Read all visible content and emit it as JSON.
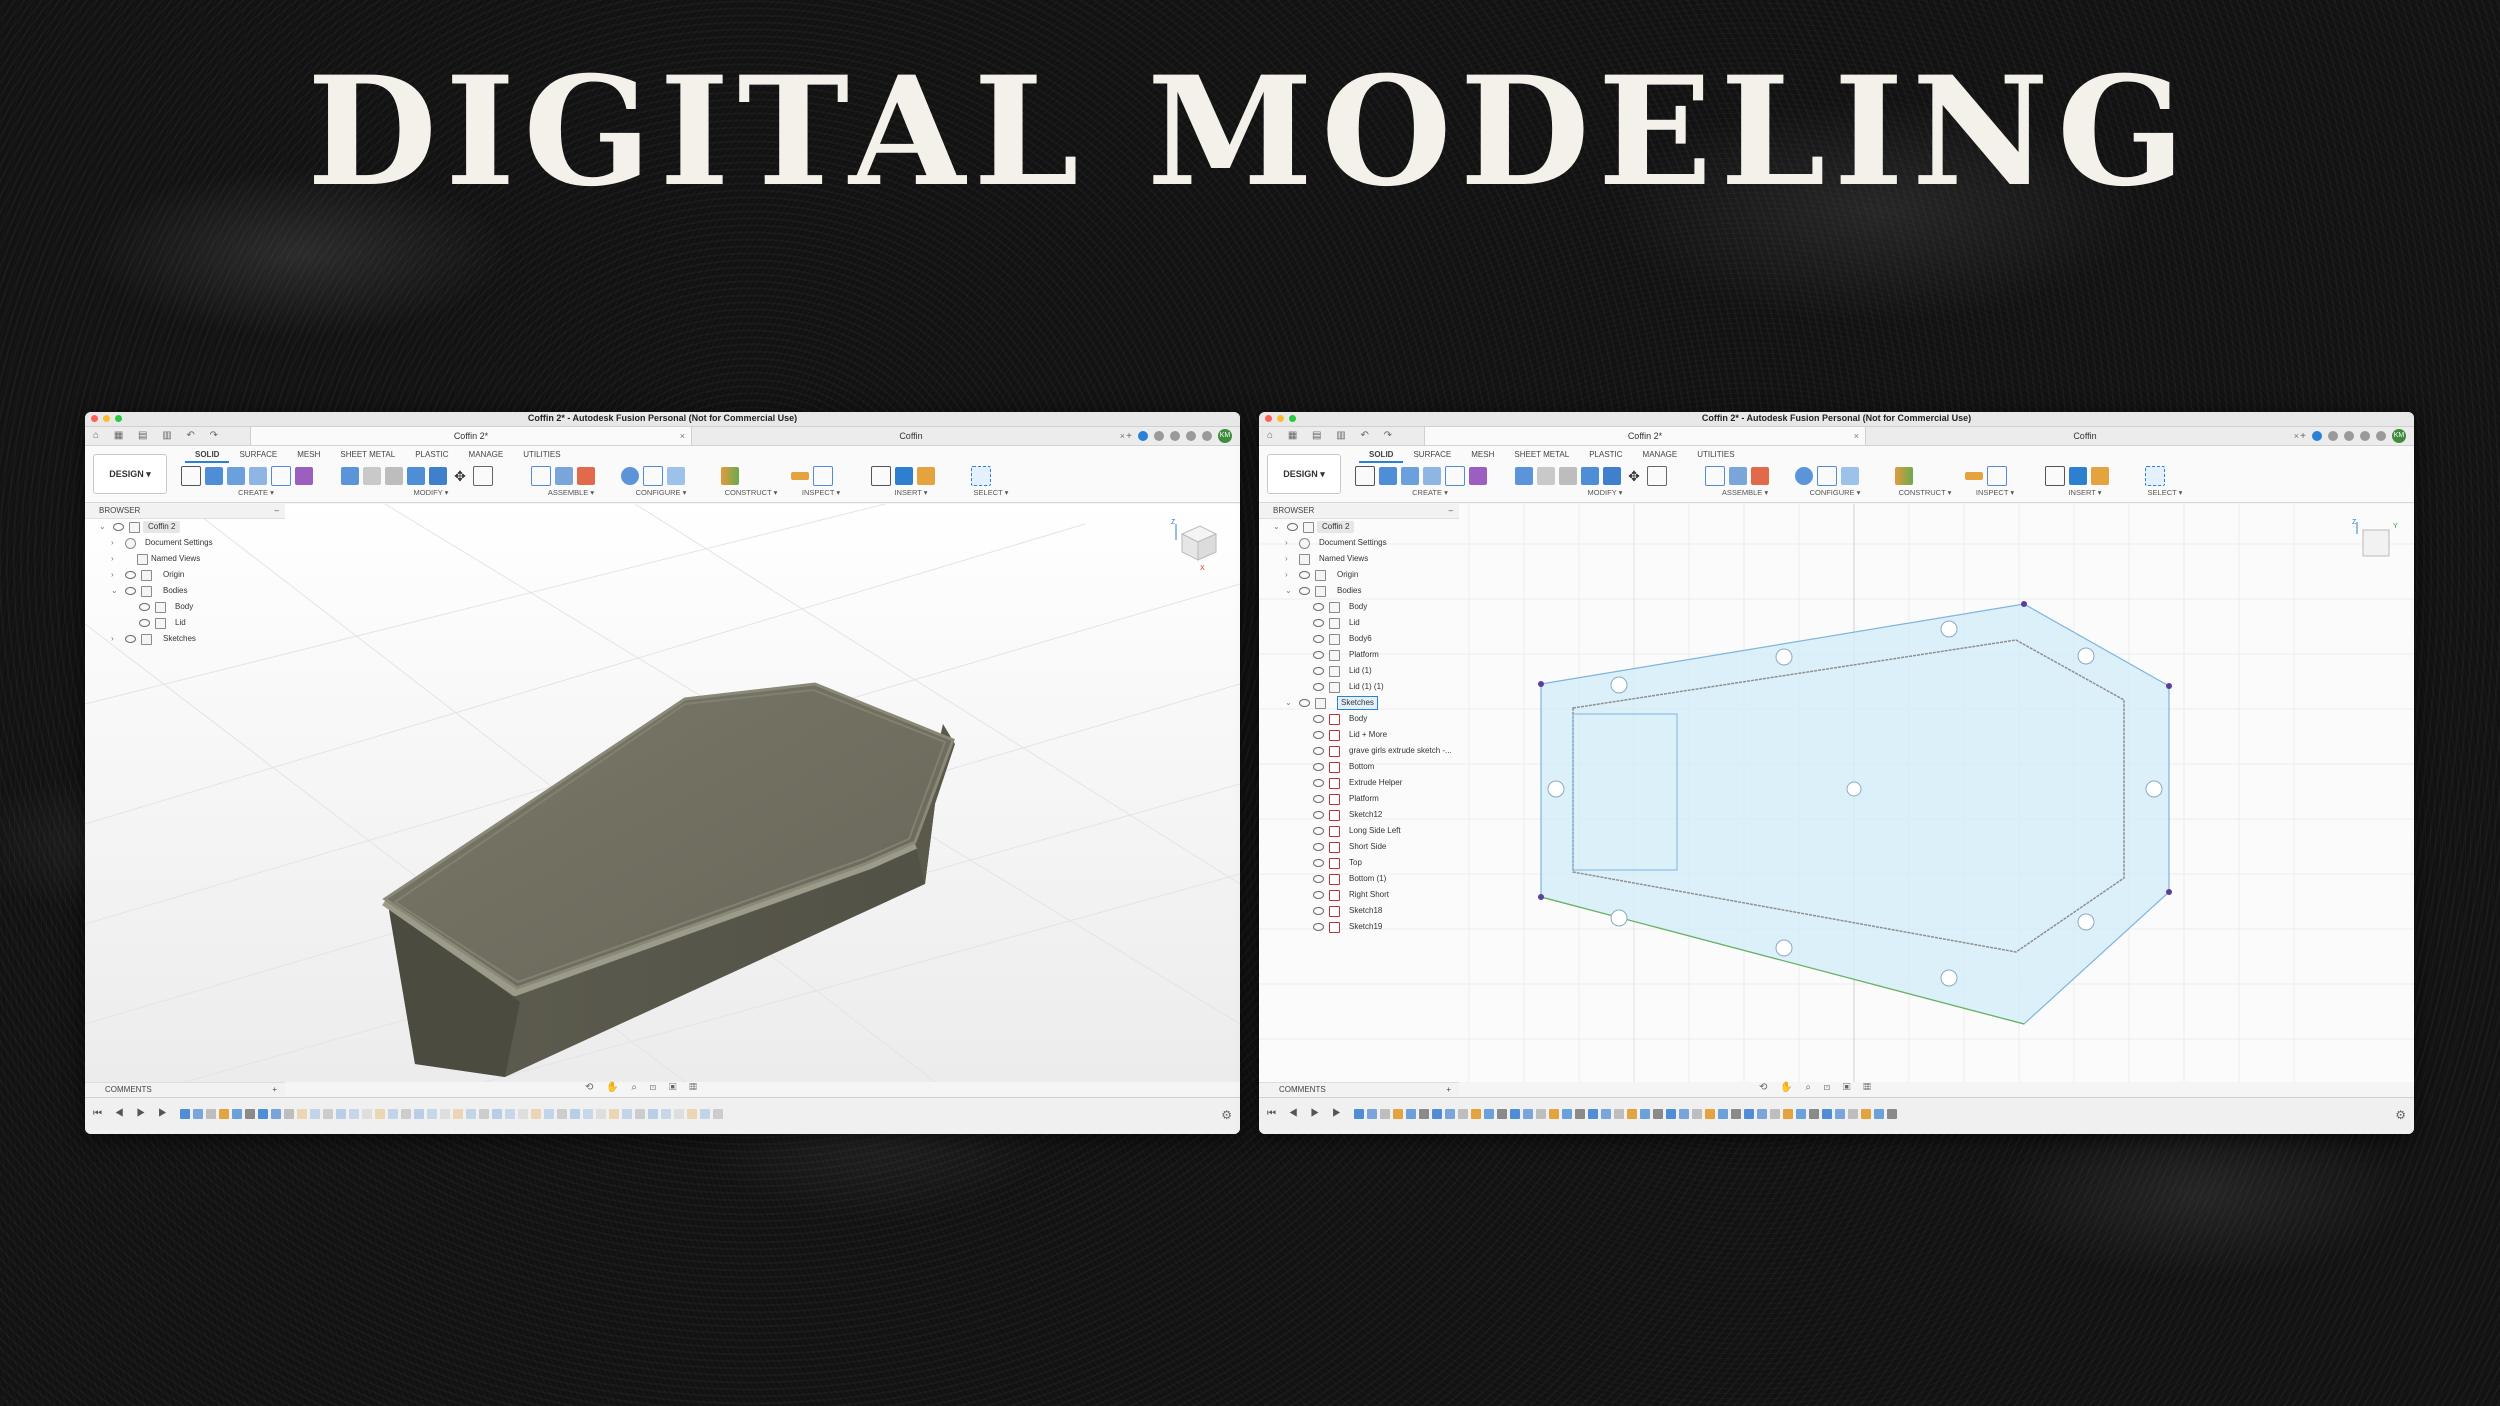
{
  "slide_title": "DIGITAL MODELING",
  "colors": {
    "accent": "#2a7fd6",
    "body": "#6b6a5c",
    "sketch_fill": "#cfe9f7",
    "sketch_line": "#6fa8d8"
  },
  "left": {
    "window_title": "Coffin 2* - Autodesk Fusion Personal (Not for Commercial Use)",
    "tab1": "Coffin 2*",
    "tab2": "Coffin",
    "avatar": "KM",
    "design": "DESIGN ▾",
    "workspace_tabs": [
      "SOLID",
      "SURFACE",
      "MESH",
      "SHEET METAL",
      "PLASTIC",
      "MANAGE",
      "UTILITIES"
    ],
    "groups": [
      "CREATE ▾",
      "MODIFY ▾",
      "ASSEMBLE ▾",
      "CONFIGURE ▾",
      "CONSTRUCT ▾",
      "INSPECT ▾",
      "INSERT ▾",
      "SELECT ▾"
    ],
    "browser_title": "BROWSER",
    "tree": {
      "root": "Coffin 2",
      "doc_settings": "Document Settings",
      "named_views": "Named Views",
      "origin": "Origin",
      "bodies": "Bodies",
      "body": "Body",
      "lid": "Lid",
      "sketches": "Sketches"
    },
    "comments": "COMMENTS",
    "viewcube_axes": {
      "z": "Z",
      "x": "X"
    }
  },
  "right": {
    "window_title": "Coffin 2* - Autodesk Fusion Personal (Not for Commercial Use)",
    "tab1": "Coffin 2*",
    "tab2": "Coffin",
    "avatar": "KM",
    "design": "DESIGN ▾",
    "workspace_tabs": [
      "SOLID",
      "SURFACE",
      "MESH",
      "SHEET METAL",
      "PLASTIC",
      "MANAGE",
      "UTILITIES"
    ],
    "groups": [
      "CREATE ▾",
      "MODIFY ▾",
      "ASSEMBLE ▾",
      "CONFIGURE ▾",
      "CONSTRUCT ▾",
      "INSPECT ▾",
      "INSERT ▾",
      "SELECT ▾"
    ],
    "browser_title": "BROWSER",
    "tree": {
      "root": "Coffin 2",
      "doc_settings": "Document Settings",
      "named_views": "Named Views",
      "origin": "Origin",
      "bodies": "Bodies",
      "body_items": [
        "Body",
        "Lid",
        "Body6",
        "Platform",
        "Lid (1)",
        "Lid (1) (1)"
      ],
      "sketches": "Sketches",
      "sketch_items": [
        "Body",
        "Lid + More",
        "grave girls extrude sketch -...",
        "Bottom",
        "Extrude Helper",
        "Platform",
        "Sketch12",
        "Long Side Left",
        "Short Side",
        "Top",
        "Bottom (1)",
        "Right Short",
        "Sketch18",
        "Sketch19"
      ]
    },
    "comments": "COMMENTS",
    "viewcube_axes": {
      "z": "Z",
      "y": "Y"
    }
  }
}
